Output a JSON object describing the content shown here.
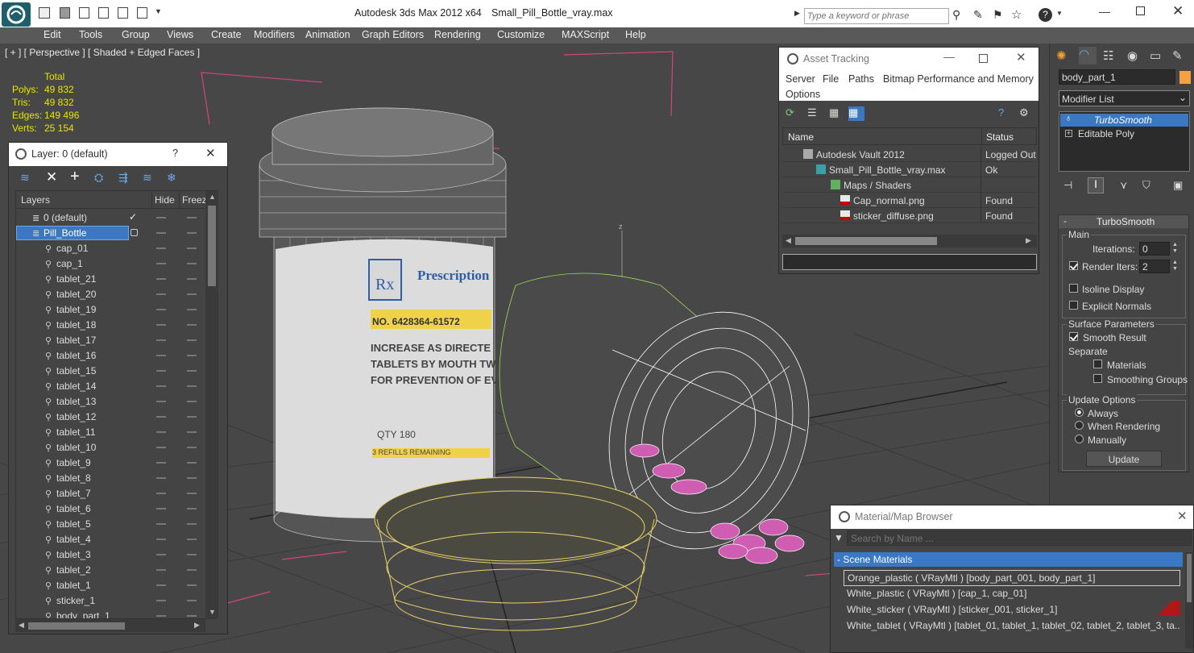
{
  "app": {
    "title": "Autodesk 3ds Max  2012 x64",
    "file": "Small_Pill_Bottle_vray.max",
    "search_placeholder": "Type a keyword or phrase"
  },
  "menu": [
    "Edit",
    "Tools",
    "Group",
    "Views",
    "Create",
    "Modifiers",
    "Animation",
    "Graph Editors",
    "Rendering",
    "Customize",
    "MAXScript",
    "Help"
  ],
  "viewport": {
    "label": "[ + ] [ Perspective ] [ Shaded + Edged Faces ]",
    "stats": {
      "header": "Total",
      "rows": [
        {
          "label": "Polys:",
          "value": "49 832"
        },
        {
          "label": "Tris:",
          "value": "49 832"
        },
        {
          "label": "Edges:",
          "value": "149 496"
        },
        {
          "label": "Verts:",
          "value": "25 154"
        }
      ]
    },
    "label_text": {
      "prescription": "Prescription",
      "number": "NO. 6428364-61572",
      "line1": "INCREASE AS DIRECTE",
      "line2": "TABLETS BY MOUTH TWI",
      "line3": "FOR PREVENTION OF EV",
      "qty": "QTY  180",
      "refills": "3 REFILLS REMAINING"
    }
  },
  "layer_window": {
    "title": "Layer: 0 (default)",
    "help": "?",
    "columns": {
      "layers": "Layers",
      "hide": "Hide",
      "freeze": "Freeze"
    },
    "layers": [
      {
        "name": "0 (default)",
        "level": 0,
        "kind": "layer",
        "current": true
      },
      {
        "name": "Pill_Bottle",
        "level": 0,
        "kind": "layer",
        "selected": true
      },
      {
        "name": "cap_01",
        "level": 1,
        "kind": "object"
      },
      {
        "name": "cap_1",
        "level": 1,
        "kind": "object"
      },
      {
        "name": "tablet_21",
        "level": 1,
        "kind": "object"
      },
      {
        "name": "tablet_20",
        "level": 1,
        "kind": "object"
      },
      {
        "name": "tablet_19",
        "level": 1,
        "kind": "object"
      },
      {
        "name": "tablet_18",
        "level": 1,
        "kind": "object"
      },
      {
        "name": "tablet_17",
        "level": 1,
        "kind": "object"
      },
      {
        "name": "tablet_16",
        "level": 1,
        "kind": "object"
      },
      {
        "name": "tablet_15",
        "level": 1,
        "kind": "object"
      },
      {
        "name": "tablet_14",
        "level": 1,
        "kind": "object"
      },
      {
        "name": "tablet_13",
        "level": 1,
        "kind": "object"
      },
      {
        "name": "tablet_12",
        "level": 1,
        "kind": "object"
      },
      {
        "name": "tablet_11",
        "level": 1,
        "kind": "object"
      },
      {
        "name": "tablet_10",
        "level": 1,
        "kind": "object"
      },
      {
        "name": "tablet_9",
        "level": 1,
        "kind": "object"
      },
      {
        "name": "tablet_8",
        "level": 1,
        "kind": "object"
      },
      {
        "name": "tablet_7",
        "level": 1,
        "kind": "object"
      },
      {
        "name": "tablet_6",
        "level": 1,
        "kind": "object"
      },
      {
        "name": "tablet_5",
        "level": 1,
        "kind": "object"
      },
      {
        "name": "tablet_4",
        "level": 1,
        "kind": "object"
      },
      {
        "name": "tablet_3",
        "level": 1,
        "kind": "object"
      },
      {
        "name": "tablet_2",
        "level": 1,
        "kind": "object"
      },
      {
        "name": "tablet_1",
        "level": 1,
        "kind": "object"
      },
      {
        "name": "sticker_1",
        "level": 1,
        "kind": "object"
      },
      {
        "name": "body_part_1",
        "level": 1,
        "kind": "object"
      }
    ]
  },
  "asset_tracking": {
    "title": "Asset Tracking",
    "menu": [
      "Server",
      "File",
      "Paths",
      "Bitmap Performance and Memory",
      "Options"
    ],
    "columns": {
      "name": "Name",
      "status": "Status"
    },
    "rows": [
      {
        "name": "Autodesk Vault 2012",
        "status": "Logged Out",
        "icon": "vault-icon"
      },
      {
        "name": "Small_Pill_Bottle_vray.max",
        "status": "Ok",
        "icon": "max-file-icon"
      },
      {
        "name": "Maps / Shaders",
        "status": "",
        "icon": "maps-icon"
      },
      {
        "name": "Cap_normal.png",
        "status": "Found",
        "icon": "png-icon"
      },
      {
        "name": "sticker_diffuse.png",
        "status": "Found",
        "icon": "png-icon"
      }
    ]
  },
  "command_panel": {
    "object_name": "body_part_1",
    "modifier_list": "Modifier List",
    "stack": [
      "TurboSmooth",
      "Editable Poly"
    ],
    "rollout_title": "TurboSmooth",
    "main_group": "Main",
    "iterations_label": "Iterations:",
    "iterations_value": "0",
    "render_iters_label": "Render Iters:",
    "render_iters_value": "2",
    "isoline_label": "Isoline Display",
    "explicit_normals_label": "Explicit Normals",
    "surface_group": "Surface Parameters",
    "smooth_result_label": "Smooth Result",
    "separate_label": "Separate",
    "materials_label": "Materials",
    "smoothing_groups_label": "Smoothing Groups",
    "update_group": "Update Options",
    "always_label": "Always",
    "when_rendering_label": "When Rendering",
    "manually_label": "Manually",
    "update_button": "Update"
  },
  "material_browser": {
    "title": "Material/Map Browser",
    "search_placeholder": "Search by Name ...",
    "section": "- Scene Materials",
    "materials": [
      "Orange_plastic  ( VRayMtl ) [body_part_001, body_part_1]",
      "White_plastic  ( VRayMtl ) [cap_1, cap_01]",
      "White_sticker  ( VRayMtl ) [sticker_001, sticker_1]",
      "White_tablet  ( VRayMtl ) [tablet_01, tablet_1, tablet_02, tablet_2, tablet_3, ta..."
    ]
  },
  "colors": {
    "accent_blue": "#3b78c4",
    "stats_yellow": "#e6e600",
    "selection_magenta": "#c0308a",
    "wire_yellow": "#e8d16a",
    "wire_green": "#9fdc5a"
  }
}
